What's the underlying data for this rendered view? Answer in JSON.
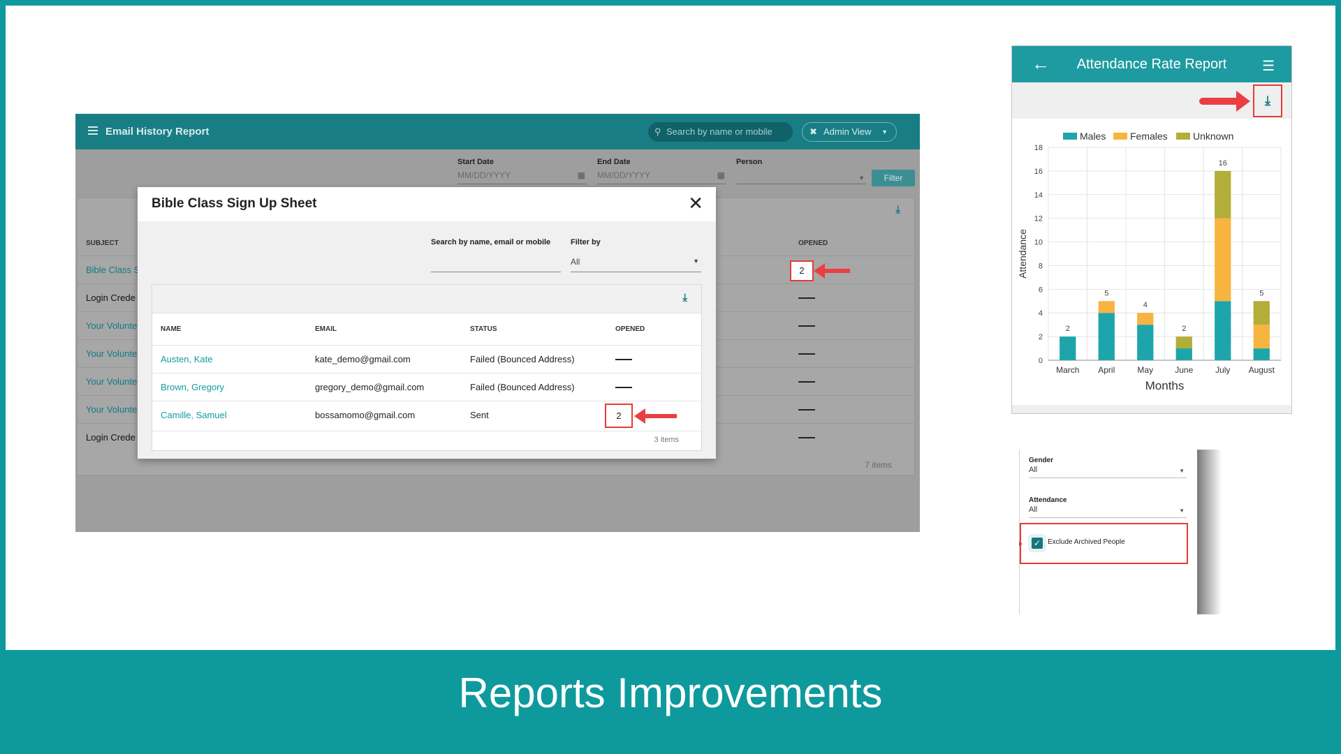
{
  "footer": {
    "title": "Reports Improvements"
  },
  "email_report": {
    "title": "Email History Report",
    "search_placeholder": "Search by name or mobile",
    "admin_label": "Admin View",
    "start_date_label": "Start Date",
    "start_date_placeholder": "MM/DD/YYYY",
    "end_date_label": "End Date",
    "end_date_placeholder": "MM/DD/YYYY",
    "person_label": "Person",
    "filter_button": "Filter",
    "col_subject": "SUBJECT",
    "col_opened": "OPENED",
    "rows": [
      {
        "subject": "Bible Class S",
        "opened": "2"
      },
      {
        "subject": "Login Crede",
        "opened": ""
      },
      {
        "subject": "Your Volunte",
        "opened": ""
      },
      {
        "subject": "Your Volunte",
        "opened": ""
      },
      {
        "subject": "Your Volunte",
        "opened": ""
      },
      {
        "subject": "Your Volunte",
        "opened": ""
      },
      {
        "subject": "Login Crede",
        "opened": ""
      }
    ],
    "items": "7 items"
  },
  "modal": {
    "title": "Bible Class Sign Up Sheet",
    "search_label": "Search by name, email or mobile",
    "filter_label": "Filter by",
    "filter_value": "All",
    "col_name": "NAME",
    "col_email": "EMAIL",
    "col_status": "STATUS",
    "col_opened": "OPENED",
    "rows": [
      {
        "name": "Austen, Kate",
        "email": "kate_demo@gmail.com",
        "status": "Failed (Bounced Address)",
        "opened": ""
      },
      {
        "name": "Brown, Gregory",
        "email": "gregory_demo@gmail.com",
        "status": "Failed (Bounced Address)",
        "opened": ""
      },
      {
        "name": "Camille, Samuel",
        "email": "bossamomo@gmail.com",
        "status": "Sent",
        "opened": "2"
      }
    ],
    "items": "3 items"
  },
  "attendance": {
    "title": "Attendance Rate Report",
    "legend": [
      "Males",
      "Females",
      "Unknown"
    ]
  },
  "chart_data": {
    "type": "bar",
    "stacked": true,
    "categories": [
      "March",
      "April",
      "May",
      "June",
      "July",
      "August"
    ],
    "series": [
      {
        "name": "Males",
        "values": [
          2,
          4,
          3,
          1,
          5,
          1
        ],
        "color": "#1ea5ab"
      },
      {
        "name": "Females",
        "values": [
          0,
          1,
          1,
          0,
          7,
          2
        ],
        "color": "#f7b441"
      },
      {
        "name": "Unknown",
        "values": [
          0,
          0,
          0,
          1,
          4,
          2
        ],
        "color": "#b3ad3a"
      }
    ],
    "totals": [
      "2",
      "5",
      "4",
      "2",
      "16",
      "5"
    ],
    "yticks": [
      "0",
      "2",
      "4",
      "6",
      "8",
      "10",
      "12",
      "14",
      "16",
      "18"
    ],
    "ylim": [
      0,
      18
    ],
    "xlabel": "Months",
    "ylabel": "Attendance",
    "grid": true,
    "legend_position": "top"
  },
  "filters": {
    "gender_label": "Gender",
    "gender_value": "All",
    "attendance_label": "Attendance",
    "attendance_value": "All",
    "exclude_label": "Exclude Archived People"
  }
}
